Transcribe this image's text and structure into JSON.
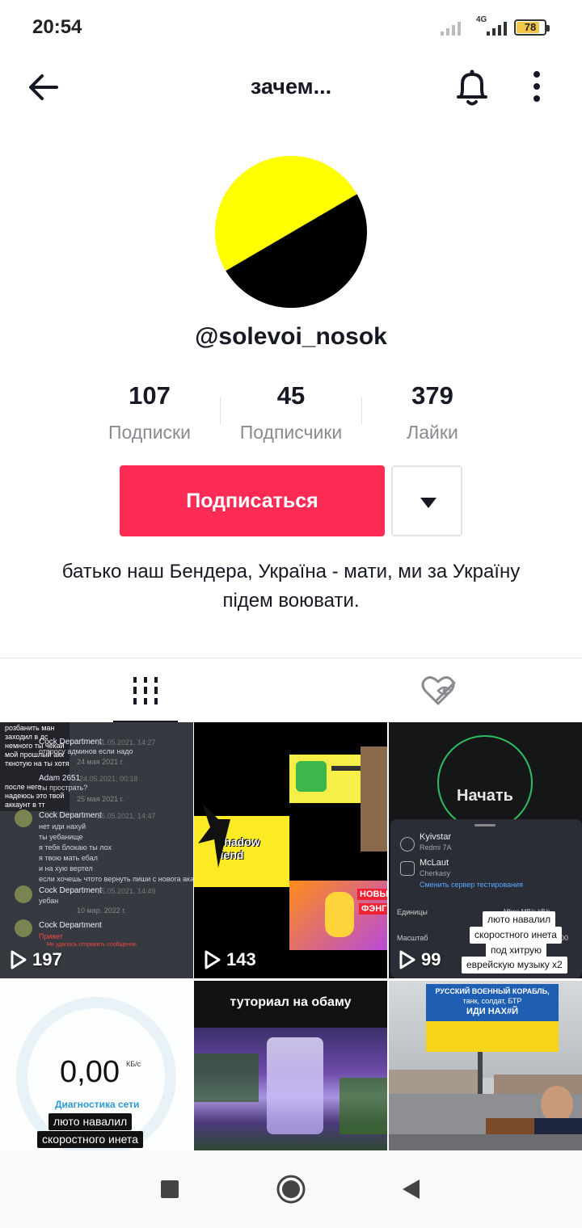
{
  "status_bar": {
    "time": "20:54",
    "network": "4G",
    "battery": "78"
  },
  "header": {
    "title": "зачем..."
  },
  "profile": {
    "username": "@solevoi_nosok",
    "stats": [
      {
        "value": "107",
        "label": "Подписки"
      },
      {
        "value": "45",
        "label": "Подписчики"
      },
      {
        "value": "379",
        "label": "Лайки"
      }
    ],
    "follow_label": "Подписаться",
    "bio": "батько наш Бендера, Україна - мати, ми за Україну підем воювати.",
    "avatar_colors": {
      "top": "#ffff00",
      "bottom": "#000000"
    }
  },
  "videos": [
    {
      "views": "197",
      "chat": {
        "lines_top": [
          "розбанить ман",
          "заходил в дс",
          "немного ты чёкай",
          "мой прошлый акк",
          "ткнотую на ты хотя",
          "после него",
          "надеюсь это твой",
          "аккаунт в тт"
        ],
        "names": [
          "Cock Department",
          "Adam 2651",
          "Cock Department",
          "Cock Department",
          "Cock Department"
        ],
        "dates": [
          "21.05.2021, 14:27",
          "24 мая 2021 г.",
          "24.05.2021, 00:18",
          "25 мая 2021 г.",
          "25.05.2021, 14:47",
          "25.05.2021, 14:49",
          "10 мар. 2022 г."
        ],
        "messages": [
          "отпросу админов если надо",
          "ты прострать?",
          "нет иди нахуй",
          "ты уебанище",
          "я тебя блокаю ты лох",
          "я твою мать ебал",
          "и на хую вертел",
          "если хочешь чтото вернуть пиши с новога ака",
          "уебан",
          "Привет",
          "Не удалось отправить сообщение"
        ]
      }
    },
    {
      "views": "143",
      "texts": [
        "Shadow fiend",
        "НОВЫЙ",
        "ФЭНГ"
      ]
    },
    {
      "views": "99",
      "start": "Начать",
      "provider": "Kyivstar",
      "device": "Redmi 7A",
      "server": "McLaut",
      "city": "Cherkasy",
      "change_server": "Сменить сервер тестирования",
      "units_label": "Единицы",
      "units": "Mbps  MB/s  kB/s",
      "scale_label": "Масштаб",
      "scale": "00",
      "caption": [
        "лютo навалил",
        "скоростного инета",
        "под хитрую",
        "еврейскую музыку x2"
      ]
    },
    {
      "value": "0,00",
      "unit": "КБ/с",
      "label": "Диагностика сети",
      "caption": [
        "лютo навалил",
        "скоростного инета"
      ]
    },
    {
      "caption": "туториал на обаму"
    },
    {
      "billboard": [
        "РУССКИЙ ВОЕННЫЙ КОРАБЛЬ,",
        "танк, солдат, БТР",
        "ИДИ НАХ#Й"
      ]
    }
  ],
  "icons": {
    "back": "arrow-left-icon",
    "bell": "bell-icon",
    "more": "more-vertical-icon",
    "grid": "grid-icon",
    "liked_hidden": "heart-hidden-icon",
    "play": "play-icon",
    "nav_recents": "square-icon",
    "nav_home": "circle-icon",
    "nav_back": "triangle-back-icon"
  },
  "colors": {
    "follow_button": "#fe2c55",
    "text": "#161823",
    "muted": "#8a8b91"
  }
}
